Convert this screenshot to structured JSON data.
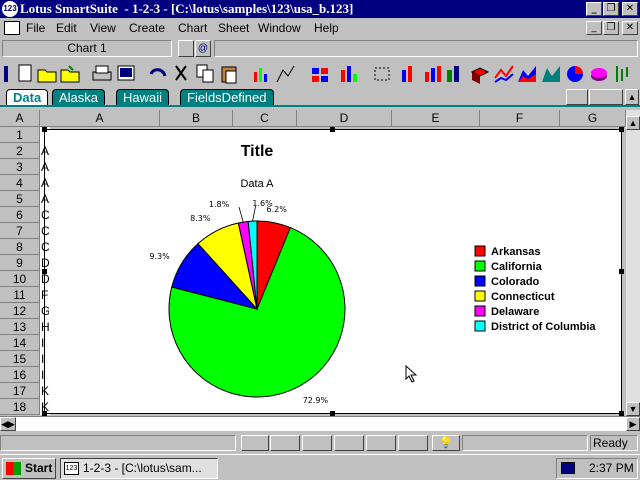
{
  "window": {
    "app_title": "Lotus SmartSuite",
    "doc_title": "1-2-3 - [C:\\lotus\\samples\\123\\usa_b.123]"
  },
  "menu": [
    "File",
    "Edit",
    "View",
    "Create",
    "Chart",
    "Sheet",
    "Window",
    "Help"
  ],
  "name_box": "Chart 1",
  "tabs": [
    "Data",
    "Alaska",
    "Hawaii",
    "FieldsDefined"
  ],
  "columns": [
    "A",
    "A",
    "B",
    "C",
    "D",
    "E",
    "F",
    "G"
  ],
  "rows": [
    "1",
    "2",
    "3",
    "4",
    "5",
    "6",
    "7",
    "8",
    "9",
    "10",
    "11",
    "12",
    "13",
    "14",
    "15",
    "16",
    "17",
    "18"
  ],
  "col_a_fragments": [
    "",
    "A",
    "A",
    "A",
    "A",
    "C",
    "C",
    "C",
    "D",
    "D",
    "F",
    "G",
    "H",
    "I",
    "I",
    "I",
    "K",
    "K"
  ],
  "status": "Ready",
  "taskbar": {
    "start": "Start",
    "task": "1-2-3 - [C:\\lotus\\sam...",
    "clock": "2:37 PM"
  },
  "chart_data": {
    "type": "pie",
    "title": "Title",
    "subtitle": "Data A",
    "categories": [
      "Arkansas",
      "California",
      "Colorado",
      "Connecticut",
      "Delaware",
      "District of Columbia"
    ],
    "values": [
      6.2,
      72.9,
      9.3,
      8.3,
      1.8,
      1.6
    ],
    "value_labels": [
      "6.2%",
      "72.9%",
      "9.3%",
      "8.3%",
      "1.8%",
      "1.6%"
    ],
    "colors": [
      "#ff0000",
      "#00ff00",
      "#0000ff",
      "#ffff00",
      "#ff00ff",
      "#00ffff"
    ],
    "legend_position": "right"
  }
}
